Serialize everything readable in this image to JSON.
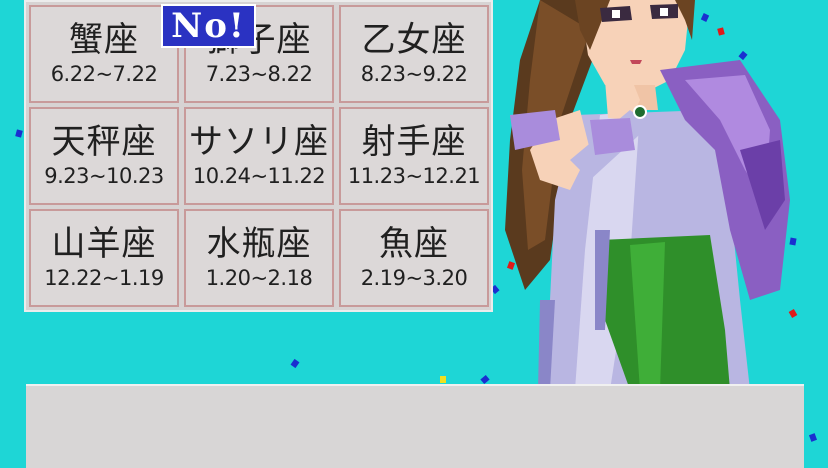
{
  "badge": {
    "text": "No!"
  },
  "zodiac": [
    {
      "name": "蟹座",
      "range": "6.22~7.22"
    },
    {
      "name": "獅子座",
      "range": "7.23~8.22"
    },
    {
      "name": "乙女座",
      "range": "8.23~9.22"
    },
    {
      "name": "天秤座",
      "range": "9.23~10.23"
    },
    {
      "name": "サソリ座",
      "range": "10.24~11.22"
    },
    {
      "name": "射手座",
      "range": "11.23~12.21"
    },
    {
      "name": "山羊座",
      "range": "12.22~1.19"
    },
    {
      "name": "水瓶座",
      "range": "1.20~2.18"
    },
    {
      "name": "魚座",
      "range": "2.19~3.20"
    }
  ],
  "dialogue": {
    "text": ""
  },
  "colors": {
    "background": "#1ed6d6",
    "badge": "#2a32c2",
    "cell_border": "#c89a9a",
    "panel": "#d8d6d6"
  }
}
